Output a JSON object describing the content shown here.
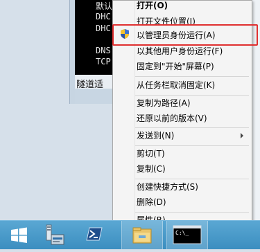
{
  "console": {
    "lines": [
      "默认",
      "DHC",
      "DHC",
      "",
      "DNS",
      "TCP"
    ],
    "bottom_text": "隧道适"
  },
  "context_menu": {
    "items": [
      {
        "label": "打开(O)",
        "bold": true
      },
      {
        "label": "打开文件位置(I)"
      },
      {
        "label": "以管理员身份运行(A)",
        "icon": "uac-shield-icon",
        "highlighted": true
      },
      {
        "label": "以其他用户身份运行(F)"
      },
      {
        "label": "固定到\"开始\"屏幕(P)"
      },
      {
        "label": "从任务栏取消固定(K)"
      },
      {
        "label": "复制为路径(A)"
      },
      {
        "label": "还原以前的版本(V)"
      },
      {
        "label": "发送到(N)",
        "submenu": true
      },
      {
        "label": "剪切(T)"
      },
      {
        "label": "复制(C)"
      },
      {
        "label": "创建快捷方式(S)"
      },
      {
        "label": "删除(D)"
      },
      {
        "label": "属性(R)"
      }
    ]
  },
  "taskbar": {
    "items": [
      {
        "name": "start-icon"
      },
      {
        "name": "server-manager-icon"
      },
      {
        "name": "powershell-icon"
      },
      {
        "name": "file-explorer-icon"
      },
      {
        "name": "cmd-icon",
        "label": "C:\\_"
      }
    ]
  },
  "colors": {
    "highlight_border": "#e03030",
    "taskbar": "#3b8ec0"
  }
}
